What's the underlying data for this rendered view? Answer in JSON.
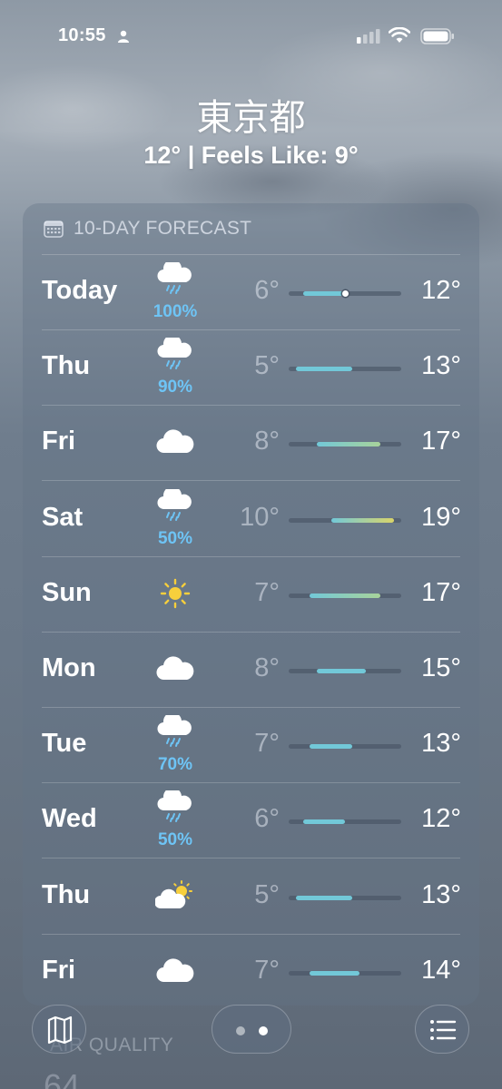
{
  "status_bar": {
    "time": "10:55"
  },
  "header": {
    "city": "東京都",
    "subtitle": "12°  |  Feels Like: 9°"
  },
  "forecast": {
    "title": "10-DAY FORECAST",
    "days": [
      {
        "day": "Today",
        "icon": "cloud-rain-icon",
        "precip": "100%",
        "low": "6°",
        "high": "12°",
        "low_value": 6,
        "high_value": 12,
        "current": 12
      },
      {
        "day": "Thu",
        "icon": "cloud-rain-icon",
        "precip": "90%",
        "low": "5°",
        "high": "13°",
        "low_value": 5,
        "high_value": 13
      },
      {
        "day": "Fri",
        "icon": "cloud-icon",
        "precip": "",
        "low": "8°",
        "high": "17°",
        "low_value": 8,
        "high_value": 17
      },
      {
        "day": "Sat",
        "icon": "cloud-rain-icon",
        "precip": "50%",
        "low": "10°",
        "high": "19°",
        "low_value": 10,
        "high_value": 19
      },
      {
        "day": "Sun",
        "icon": "sun-icon",
        "precip": "",
        "low": "7°",
        "high": "17°",
        "low_value": 7,
        "high_value": 17
      },
      {
        "day": "Mon",
        "icon": "cloud-icon",
        "precip": "",
        "low": "8°",
        "high": "15°",
        "low_value": 8,
        "high_value": 15
      },
      {
        "day": "Tue",
        "icon": "cloud-rain-icon",
        "precip": "70%",
        "low": "7°",
        "high": "13°",
        "low_value": 7,
        "high_value": 13
      },
      {
        "day": "Wed",
        "icon": "cloud-rain-icon",
        "precip": "50%",
        "low": "6°",
        "high": "12°",
        "low_value": 6,
        "high_value": 12
      },
      {
        "day": "Thu",
        "icon": "cloud-sun-icon",
        "precip": "",
        "low": "5°",
        "high": "13°",
        "low_value": 5,
        "high_value": 13
      },
      {
        "day": "Fri",
        "icon": "cloud-icon",
        "precip": "",
        "low": "7°",
        "high": "14°",
        "low_value": 7,
        "high_value": 14
      }
    ],
    "range_min": 4,
    "range_max": 20
  },
  "next_section": {
    "title": "AIR QUALITY",
    "value": "64"
  },
  "colors": {
    "precip": "#6ec4f5",
    "cool": "#72c8d8",
    "mild": "#a8d39a",
    "warm": "#d9d46a"
  },
  "toolbar": {
    "map_icon": "map-icon",
    "list_icon": "list-icon",
    "page_dots": 2,
    "active_page": 2
  }
}
